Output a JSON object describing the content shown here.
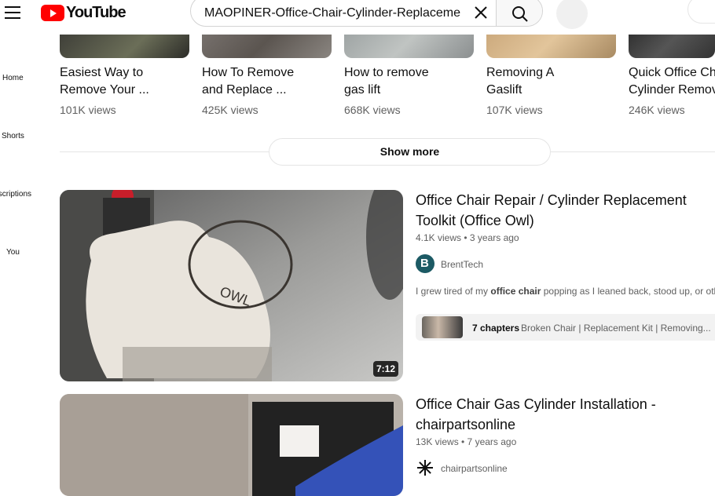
{
  "header": {
    "logo_text": "YouTube",
    "search_value": "MAOPINER-Office-Chair-Cylinder-Replacement",
    "brand_color": "#ff0000"
  },
  "sidebar": {
    "items": [
      {
        "label": "Home"
      },
      {
        "label": "Shorts"
      },
      {
        "label": "Subscriptions"
      },
      {
        "label": "You"
      }
    ]
  },
  "shorts": [
    {
      "title_line1": "Easiest Way to",
      "title_line2": "Remove Your ...",
      "views": "101K views"
    },
    {
      "title_line1": "How To Remove",
      "title_line2": "and Replace ...",
      "views": "425K views"
    },
    {
      "title_line1": "How to remove",
      "title_line2": "gas lift",
      "views": "668K views"
    },
    {
      "title_line1": "Removing A",
      "title_line2": "Gaslift",
      "views": "107K views"
    },
    {
      "title_line1": "Quick Office Ch",
      "title_line2": "Cylinder Remov",
      "views": "246K views"
    }
  ],
  "show_more_label": "Show more",
  "videos": [
    {
      "title_line1": "Office Chair Repair / Cylinder Replacement",
      "title_line2": "Toolkit (Office Owl)",
      "meta": "4.1K views • 3 years ago",
      "channel": "BrentTech",
      "avatar_letter": "B",
      "duration": "7:12",
      "desc_pre": "I grew tired of my ",
      "desc_bold": "office chair",
      "desc_post": " popping as I leaned back, stood up, or oth",
      "chapters_count": "7 chapters",
      "chapters_list": "Broken Chair | Replacement Kit | Removing..."
    },
    {
      "title_line1": "Office Chair Gas Cylinder Installation -",
      "title_line2": "chairpartsonline",
      "meta": "13K views • 7 years ago",
      "channel": "chairpartsonline"
    }
  ]
}
